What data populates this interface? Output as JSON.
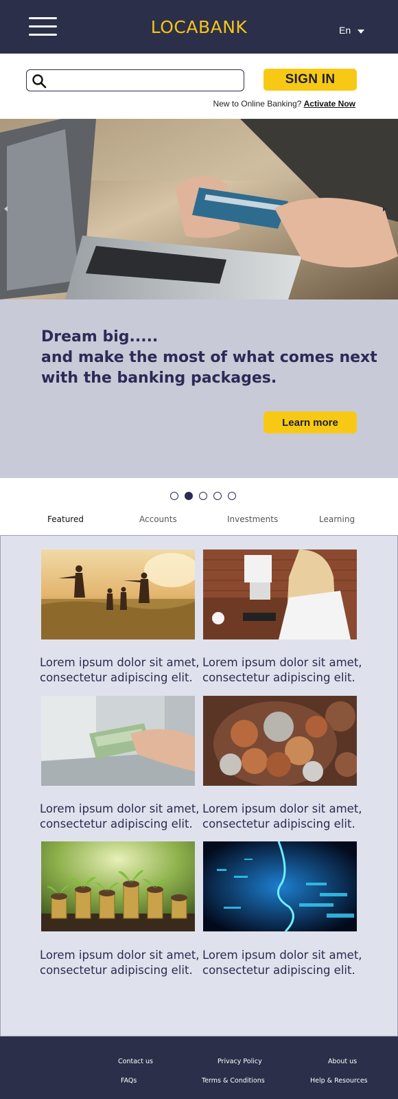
{
  "header": {
    "brand": "LOCABANK",
    "language": "En"
  },
  "search": {
    "placeholder": "",
    "value": ""
  },
  "signin": {
    "label": "SIGN IN",
    "new_user_text": "New to Online Banking?",
    "activate_link": "Activate Now"
  },
  "hero": {
    "line1": "Dream big.....",
    "line2": "and make the most of what comes next",
    "line3": "with the banking packages.",
    "button": "Learn more",
    "slide_count": 5,
    "active_slide": 2
  },
  "tabs": [
    {
      "label": "Featured",
      "active": true
    },
    {
      "label": "Accounts",
      "active": false
    },
    {
      "label": "Investments",
      "active": false
    },
    {
      "label": "Learning",
      "active": false
    }
  ],
  "cards": [
    {
      "line1": "Lorem ipsum dolor sit amet,",
      "line2": "consectetur adipiscing elit.",
      "image": "family-running-field"
    },
    {
      "line1": "Lorem ipsum dolor sit amet,",
      "line2": "consectetur adipiscing elit.",
      "image": "woman-at-desk"
    },
    {
      "line1": "Lorem ipsum dolor sit amet,",
      "line2": "consectetur adipiscing elit.",
      "image": "cash-at-teller"
    },
    {
      "line1": "Lorem ipsum dolor sit amet,",
      "line2": "consectetur adipiscing elit.",
      "image": "coin-jar"
    },
    {
      "line1": "Lorem ipsum dolor sit amet,",
      "line2": "consectetur adipiscing elit.",
      "image": "plants-on-coins"
    },
    {
      "line1": "Lorem ipsum dolor sit amet,",
      "line2": "consectetur adipiscing elit.",
      "image": "digital-circuit"
    }
  ],
  "footer": {
    "links": [
      "Contact us",
      "Privacy Policy",
      "About us",
      "FAQs",
      "Terms & Conditions",
      "Help & Resources"
    ]
  },
  "colors": {
    "navy": "#2b2f4a",
    "accent_yellow": "#f8c914",
    "hero_panel": "#c8cad8",
    "content_bg": "#dfe2ed"
  }
}
